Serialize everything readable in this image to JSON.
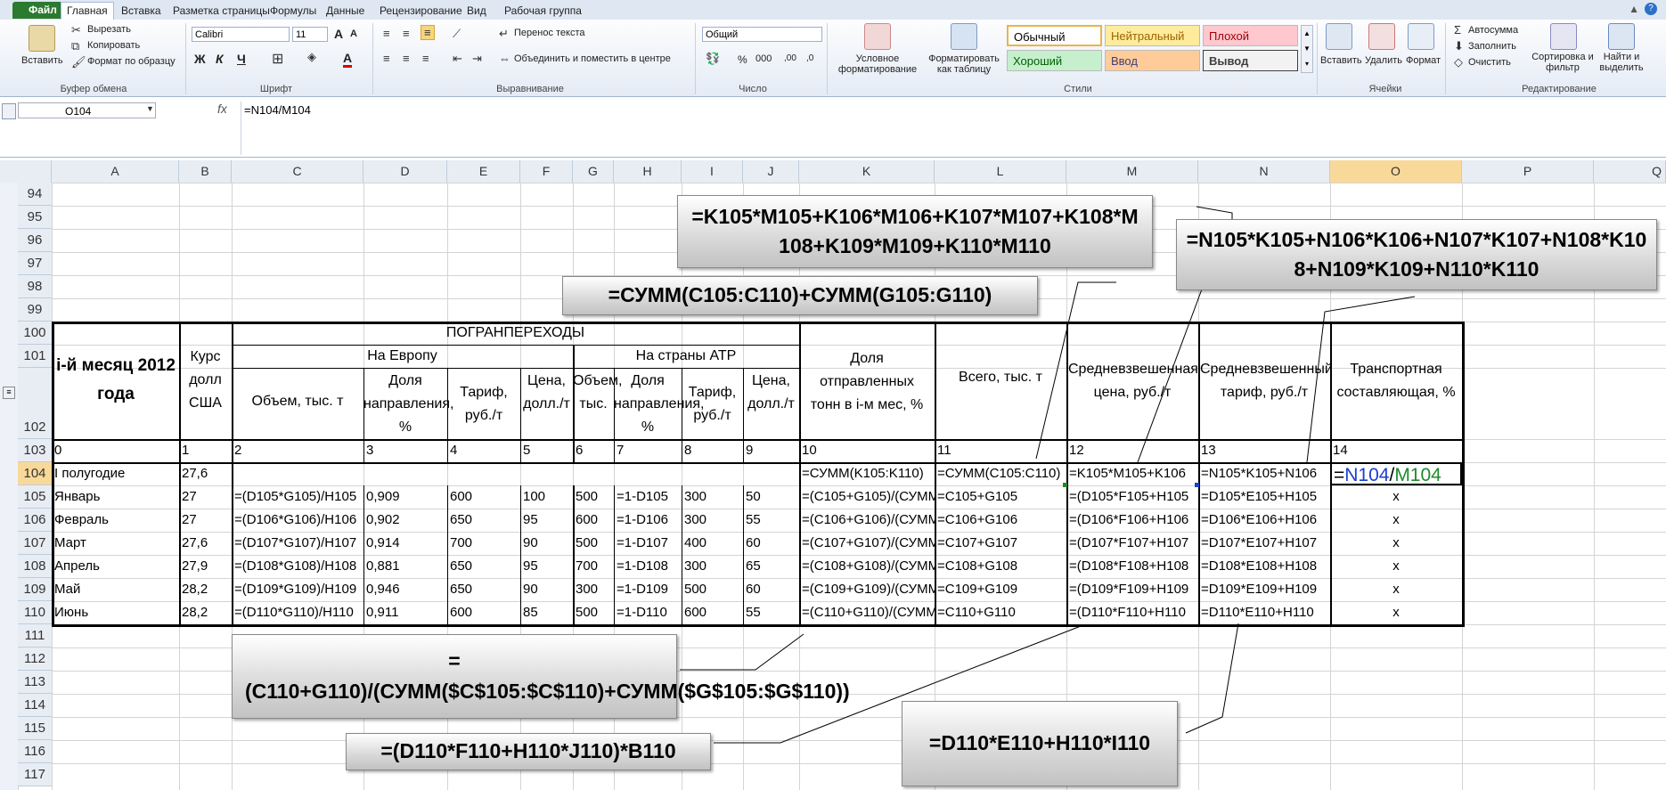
{
  "ribbon_tabs": [
    "Файл",
    "Главная",
    "Вставка",
    "Разметка страницы",
    "Формулы",
    "Данные",
    "Рецензирование",
    "Вид",
    "Рабочая группа"
  ],
  "clipboard": {
    "paste": "Вставить",
    "cut": "Вырезать",
    "copy": "Копировать",
    "painter": "Формат по образцу",
    "group": "Буфер обмена"
  },
  "font": {
    "name": "Calibri",
    "size": "11",
    "group": "Шрифт",
    "bold": "Ж",
    "italic": "К",
    "underline": "Ч",
    "grow": "A",
    "shrink": "A",
    "font_color": "A"
  },
  "alignment": {
    "wrap": "Перенос текста",
    "merge": "Объединить и поместить в центре",
    "group": "Выравнивание"
  },
  "number": {
    "format": "Общий",
    "percent": "%",
    "thousands": "000",
    "inc_dec": ",00",
    "dec_dec": ",0",
    "group": "Число"
  },
  "styles": {
    "conditional": "Условное форматирование",
    "table": "Форматировать как таблицу",
    "normal": "Обычный",
    "neutral": "Нейтральный",
    "bad": "Плохой",
    "good": "Хороший",
    "input": "Ввод",
    "output": "Вывод",
    "group": "Стили"
  },
  "cells": {
    "insert": "Вставить",
    "delete": "Удалить",
    "format": "Формат",
    "group": "Ячейки"
  },
  "editing": {
    "autosum": "Автосумма",
    "fill": "Заполнить",
    "clear": "Очистить",
    "sort": "Сортировка и фильтр",
    "find": "Найти и выделить",
    "group": "Редактирование"
  },
  "formula_bar": {
    "name_box": "O104",
    "fx": "fx",
    "formula": "=N104/M104"
  },
  "columns": [
    "A",
    "B",
    "C",
    "D",
    "E",
    "F",
    "G",
    "H",
    "I",
    "J",
    "K",
    "L",
    "M",
    "N",
    "O",
    "P",
    "Q"
  ],
  "rows": [
    "94",
    "95",
    "96",
    "97",
    "98",
    "99",
    "100",
    "101",
    "102",
    "103",
    "104",
    "105",
    "106",
    "107",
    "108",
    "109",
    "110",
    "111",
    "112",
    "113",
    "114",
    "115",
    "116",
    "117"
  ],
  "header": {
    "month": "i-й месяц 2012 года",
    "rate": "Курс долл США",
    "border": "ПОГРАНПЕРЕХОДЫ",
    "europe": "На Европу",
    "atr": "На страны АТР",
    "c": "Объем, тыс. т",
    "d": "Доля направления, %",
    "e": "Тариф, руб./т",
    "f": "Цена, долл./т",
    "g": "Объем, тыс.",
    "h": "Доля направления, %",
    "i": "Тариф, руб./т",
    "j": "Цена, долл./т",
    "k": "Доля отправленных тонн в i-м мес, %",
    "l": "Всего, тыс. т",
    "m": "Средневзвешенная цена, руб./т",
    "n": "Средневзвешенный тариф, руб./т",
    "o": "Транспортная составляющая, %"
  },
  "num_row": [
    "0",
    "1",
    "2",
    "3",
    "4",
    "5",
    "6",
    "7",
    "8",
    "9",
    "10",
    "11",
    "12",
    "13",
    "14"
  ],
  "table_rows": [
    {
      "a": "I полугодие",
      "b": "27,6",
      "c": "",
      "d": "",
      "e": "",
      "f": "",
      "g": "",
      "h": "",
      "i": "",
      "j": "",
      "k": "=СУММ(K105:K110)",
      "l": "=СУММ(C105:C110)",
      "m": "=K105*M105+K106",
      "n": "=N105*K105+N106",
      "o": "=N104/M104"
    },
    {
      "a": "Январь",
      "b": "27",
      "c": "=(D105*G105)/H105",
      "d": "0,909",
      "e": "600",
      "f": "100",
      "g": "500",
      "h": "=1-D105",
      "i": "300",
      "j": "50",
      "k": "=(C105+G105)/(СУММ",
      "l": "=C105+G105",
      "m": "=(D105*F105+H105",
      "n": "=D105*E105+H105",
      "o": "x"
    },
    {
      "a": "Февраль",
      "b": "27",
      "c": "=(D106*G106)/H106",
      "d": "0,902",
      "e": "650",
      "f": "95",
      "g": "600",
      "h": "=1-D106",
      "i": "300",
      "j": "55",
      "k": "=(C106+G106)/(СУММ",
      "l": "=C106+G106",
      "m": "=(D106*F106+H106",
      "n": "=D106*E106+H106",
      "o": "x"
    },
    {
      "a": "Март",
      "b": "27,6",
      "c": "=(D107*G107)/H107",
      "d": "0,914",
      "e": "700",
      "f": "90",
      "g": "500",
      "h": "=1-D107",
      "i": "400",
      "j": "60",
      "k": "=(C107+G107)/(СУММ",
      "l": "=C107+G107",
      "m": "=(D107*F107+H107",
      "n": "=D107*E107+H107",
      "o": "x"
    },
    {
      "a": "Апрель",
      "b": "27,9",
      "c": "=(D108*G108)/H108",
      "d": "0,881",
      "e": "650",
      "f": "95",
      "g": "700",
      "h": "=1-D108",
      "i": "300",
      "j": "65",
      "k": "=(C108+G108)/(СУММ",
      "l": "=C108+G108",
      "m": "=(D108*F108+H108",
      "n": "=D108*E108+H108",
      "o": "x"
    },
    {
      "a": "Май",
      "b": "28,2",
      "c": "=(D109*G109)/H109",
      "d": "0,946",
      "e": "650",
      "f": "90",
      "g": "300",
      "h": "=1-D109",
      "i": "500",
      "j": "60",
      "k": "=(C109+G109)/(СУММ",
      "l": "=C109+G109",
      "m": "=(D109*F109+H109",
      "n": "=D109*E109+H109",
      "o": "x"
    },
    {
      "a": "Июнь",
      "b": "28,2",
      "c": "=(D110*G110)/H110",
      "d": "0,911",
      "e": "600",
      "f": "85",
      "g": "500",
      "h": "=1-D110",
      "i": "600",
      "j": "55",
      "k": "=(C110+G110)/(СУММ",
      "l": "=C110+G110",
      "m": "=(D110*F110+H110",
      "n": "=D110*E110+H110",
      "o": "x"
    }
  ],
  "callouts": {
    "m104": "=K105*M105+K106*M106+K107*M107+K108*M108+K109*M109+K110*M110",
    "n104": "=N105*K105+N106*K106+N107*K107+N108*K108+N109*K109+N110*K110",
    "l104": "=СУММ(C105:C110)+СУММ(G105:G110)",
    "k110": "=(C110+G110)/(СУММ($C$105:$C$110)+СУММ($G$105:$G$110))",
    "m110": "=(D110*F110+H110*J110)*B110",
    "n110": "=D110*E110+H110*I110"
  },
  "colors": {
    "accent": "#2a7a2f",
    "selected_header": "#f9d99a",
    "ref_blue": "#1a3fcf",
    "ref_green": "#1f8a2c"
  }
}
